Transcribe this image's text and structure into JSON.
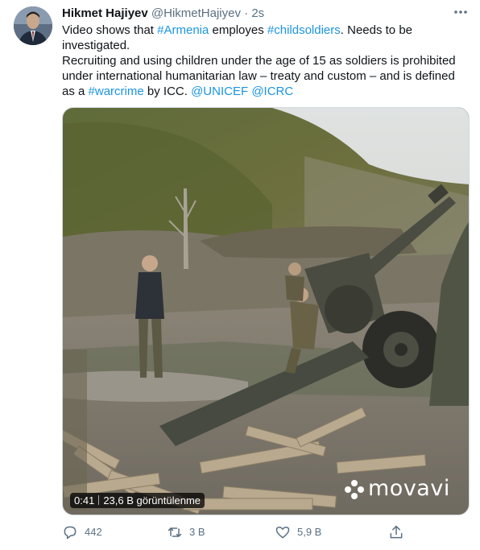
{
  "author": {
    "display_name": "Hikmet Hajiyev",
    "handle": "@HikmetHajiyev",
    "separator": "·",
    "time": "2s"
  },
  "more_icon": "more-horizontal-icon",
  "tweet": {
    "p1": {
      "t1": "Video shows that ",
      "tag1": "#Armenia",
      "t2": " employes ",
      "tag2": "#childsoldiers",
      "t3": ". Needs to be investigated."
    },
    "p2": {
      "t1": "Recruiting and using children under the age of 15 as soldiers is prohibited under international humanitarian law – treaty and custom – and is defined as a ",
      "tag1": "#warcrime",
      "t2": " by ICC. ",
      "m1": "@UNICEF",
      "m2": "@ICRC"
    }
  },
  "video": {
    "duration": "0:41",
    "views": "23,6 B görüntülenme",
    "watermark": "movavi"
  },
  "actions": {
    "reply": {
      "icon": "reply-icon",
      "count": "442"
    },
    "retweet": {
      "icon": "retweet-icon",
      "count": "3 B"
    },
    "like": {
      "icon": "heart-icon",
      "count": "5,9 B"
    },
    "share": {
      "icon": "share-icon"
    }
  },
  "colors": {
    "link": "#1b95e0",
    "meta": "#5b7083",
    "text": "#0f1419"
  }
}
